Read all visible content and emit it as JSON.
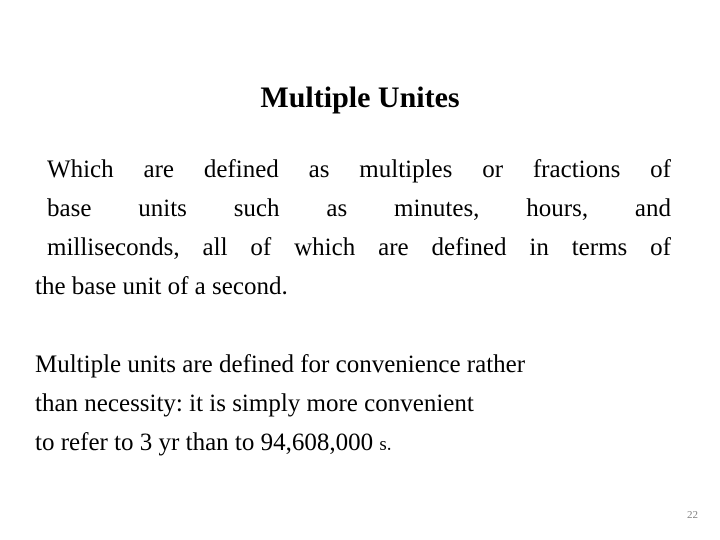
{
  "slide": {
    "background_color": "#ffffff",
    "text_color": "#000000",
    "title": "Multiple Unites",
    "paragraph_one": {
      "full_text": "Which are defined as multiples or fractions of base units such as minutes, hours, and milliseconds, all of which are defined in terms of the base unit of a second.",
      "alignment": "justified",
      "lines": [
        "Which are defined as multiples or fractions of",
        "base units such as minutes, hours, and",
        "milliseconds, all of which are defined in terms of",
        "the base unit of a second."
      ]
    },
    "paragraph_two": {
      "full_text": "Multiple units are defined for convenience rather than necessity: it is simply more convenient to refer to 3 yr than to 94,608,000 s.",
      "alignment": "left",
      "lines": [
        "Multiple units are defined for convenience rather",
        "than necessity: it is simply more convenient",
        "to refer to 3 yr than to 94,608,000 s."
      ],
      "line_three_main": "to refer to 3 yr than to 94,608,000",
      "line_three_unit": "s.",
      "quantities": {
        "years": "3 yr",
        "seconds": "94,608,000 s"
      }
    },
    "page_number": "22",
    "page_number_color": "#808080"
  }
}
